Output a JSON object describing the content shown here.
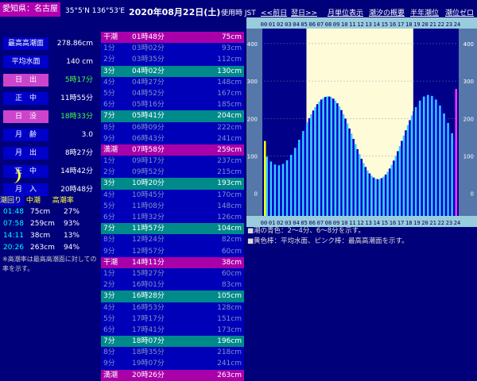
{
  "header": {
    "pref": "愛知県：名古屋",
    "coords": "35°5'N 136°53'E",
    "date": "2020年08月22日(土)",
    "timezone": "使用時 JST",
    "nav_prev": "<<前日",
    "nav_next": "翌日>>",
    "nav_month": "月単位表示",
    "nav_summary": "潮汐の概要",
    "nav_halfyear": "半年潮位",
    "nav_zero": "潮位ゼロ"
  },
  "info": [
    {
      "label": "最高高潮面",
      "value": "278.86cm",
      "style": "normal"
    },
    {
      "label": "平均水面",
      "value": "140 cm",
      "style": "normal"
    },
    {
      "label": "日　出",
      "value": "5時17分",
      "style": "sun"
    },
    {
      "label": "正　中",
      "value": "11時55分",
      "style": "normal"
    },
    {
      "label": "日　没",
      "value": "18時33分",
      "style": "sun"
    },
    {
      "label": "月　齢",
      "value": "3.0",
      "style": "normal"
    },
    {
      "label": "月　出",
      "value": "8時27分",
      "style": "normal"
    },
    {
      "label": "正　中",
      "value": "14時42分",
      "style": "normal"
    },
    {
      "label": "月　入",
      "value": "20時48分",
      "style": "normal"
    }
  ],
  "tide_summary": {
    "headers": [
      "潮回り",
      "中潮",
      "高潮率"
    ],
    "rows": [
      {
        "time": "01:48",
        "height": "75cm",
        "rate": "27%"
      },
      {
        "time": "07:58",
        "height": "259cm",
        "rate": "93%"
      },
      {
        "time": "14:11",
        "height": "38cm",
        "rate": "13%"
      },
      {
        "time": "20:26",
        "height": "263cm",
        "rate": "94%"
      }
    ],
    "note": "※高潮率は最高高潮面に対しての率を示す。"
  },
  "tide_table": [
    {
      "label": "干潮",
      "time": "01時48分",
      "height": "75cm",
      "type": "mag"
    },
    {
      "label": "1分",
      "time": "03時02分",
      "height": "93cm",
      "type": "blue"
    },
    {
      "label": "2分",
      "time": "03時35分",
      "height": "112cm",
      "type": "blue"
    },
    {
      "label": "3分",
      "time": "04時02分",
      "height": "130cm",
      "type": "teal"
    },
    {
      "label": "4分",
      "time": "04時27分",
      "height": "148cm",
      "type": "blue"
    },
    {
      "label": "5分",
      "time": "04時52分",
      "height": "167cm",
      "type": "blue"
    },
    {
      "label": "6分",
      "time": "05時16分",
      "height": "185cm",
      "type": "blue"
    },
    {
      "label": "7分",
      "time": "05時41分",
      "height": "204cm",
      "type": "teal"
    },
    {
      "label": "8分",
      "time": "06時09分",
      "height": "222cm",
      "type": "blue"
    },
    {
      "label": "9分",
      "time": "06時43分",
      "height": "241cm",
      "type": "blue"
    },
    {
      "label": "満潮",
      "time": "07時58分",
      "height": "259cm",
      "type": "mag"
    },
    {
      "label": "1分",
      "time": "09時17分",
      "height": "237cm",
      "type": "blue"
    },
    {
      "label": "2分",
      "time": "09時52分",
      "height": "215cm",
      "type": "blue"
    },
    {
      "label": "3分",
      "time": "10時20分",
      "height": "193cm",
      "type": "teal"
    },
    {
      "label": "4分",
      "time": "10時45分",
      "height": "170cm",
      "type": "blue"
    },
    {
      "label": "5分",
      "time": "11時08分",
      "height": "148cm",
      "type": "blue"
    },
    {
      "label": "6分",
      "time": "11時32分",
      "height": "126cm",
      "type": "blue"
    },
    {
      "label": "7分",
      "time": "11時57分",
      "height": "104cm",
      "type": "teal"
    },
    {
      "label": "8分",
      "time": "12時24分",
      "height": "82cm",
      "type": "blue"
    },
    {
      "label": "9分",
      "time": "12時57分",
      "height": "60cm",
      "type": "blue"
    },
    {
      "label": "干潮",
      "time": "14時11分",
      "height": "38cm",
      "type": "mag"
    },
    {
      "label": "1分",
      "time": "15時27分",
      "height": "60cm",
      "type": "blue"
    },
    {
      "label": "2分",
      "time": "16時01分",
      "height": "83cm",
      "type": "blue"
    },
    {
      "label": "3分",
      "time": "16時28分",
      "height": "105cm",
      "type": "teal"
    },
    {
      "label": "4分",
      "time": "16時53分",
      "height": "128cm",
      "type": "blue"
    },
    {
      "label": "5分",
      "time": "17時17分",
      "height": "151cm",
      "type": "blue"
    },
    {
      "label": "6分",
      "time": "17時41分",
      "height": "173cm",
      "type": "blue"
    },
    {
      "label": "7分",
      "time": "18時07分",
      "height": "196cm",
      "type": "teal"
    },
    {
      "label": "8分",
      "time": "18時35分",
      "height": "218cm",
      "type": "blue"
    },
    {
      "label": "9分",
      "time": "19時07分",
      "height": "241cm",
      "type": "blue"
    },
    {
      "label": "満潮",
      "time": "20時26分",
      "height": "263cm",
      "type": "mag"
    }
  ],
  "chart_data": {
    "type": "bar",
    "x_tick_labels": [
      "00",
      "01",
      "02",
      "03",
      "04",
      "05",
      "06",
      "07",
      "08",
      "09",
      "10",
      "11",
      "12",
      "13",
      "14",
      "15",
      "16",
      "17",
      "18",
      "19",
      "20",
      "21",
      "22",
      "23",
      "24"
    ],
    "y_ticks": [
      0,
      100,
      200,
      300,
      400
    ],
    "ylim": [
      -60,
      440
    ],
    "xlim": [
      0,
      24
    ],
    "sunrise_hour": 5.28,
    "sunset_hour": 18.55,
    "mean_level": 140,
    "max_level": 278.86,
    "lows": [
      [
        1.8,
        75
      ],
      [
        14.18,
        38
      ]
    ],
    "highs": [
      [
        7.97,
        259
      ],
      [
        20.43,
        263
      ]
    ],
    "colors": {
      "dark": "#0000cc",
      "light": "#33ccff",
      "sky_day": "#fdfbd8",
      "sky_night": "#000088",
      "mean_bar": "#ffff00",
      "max_bar": "#ff33ff"
    }
  },
  "legend": [
    "■潮の青色：2～4分、6～8分を示す。",
    "■黄色棒：平均水面、ピンク棒：最高高潮面を示す。"
  ]
}
